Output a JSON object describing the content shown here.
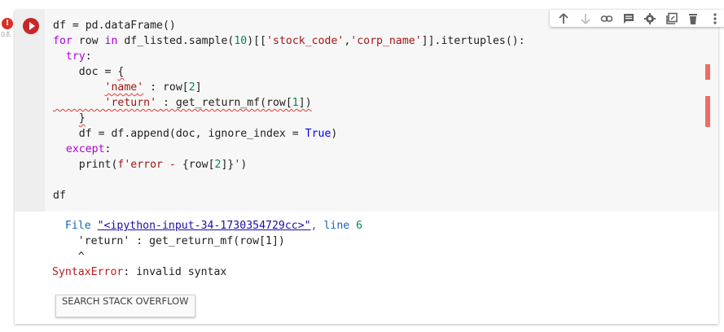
{
  "cell": {
    "error_indicator": "!",
    "exec_count": "0초",
    "code_lines": [
      "df = pd.dataFrame()",
      "for row in df_listed.sample(10)[['stock_code','corp_name']].itertuples():",
      "  try:",
      "    doc = {",
      "        'name' : row[2]",
      "        'return' : get_return_mf(row[1])",
      "    }",
      "    df = df.append(doc, ignore_index = True)",
      "  except:",
      "    print(f'error - {row[2]}')",
      "",
      "df"
    ]
  },
  "output": {
    "file_prefix": "  File ",
    "file_link": "\"<ipython-input-34-1730354729cc>\"",
    "line_sep": ", line ",
    "line_num": "6",
    "err_code": "    'return' : get_return_mf(row[1])",
    "caret": "    ^",
    "error_name": "SyntaxError",
    "error_msg": ": invalid syntax",
    "so_button": "SEARCH STACK OVERFLOW"
  },
  "toolbar": {
    "icons": [
      "arrow-up-icon",
      "arrow-down-icon",
      "link-icon",
      "comment-icon",
      "gear-icon",
      "mirror-cell-icon",
      "delete-icon",
      "more-vert-icon"
    ]
  }
}
